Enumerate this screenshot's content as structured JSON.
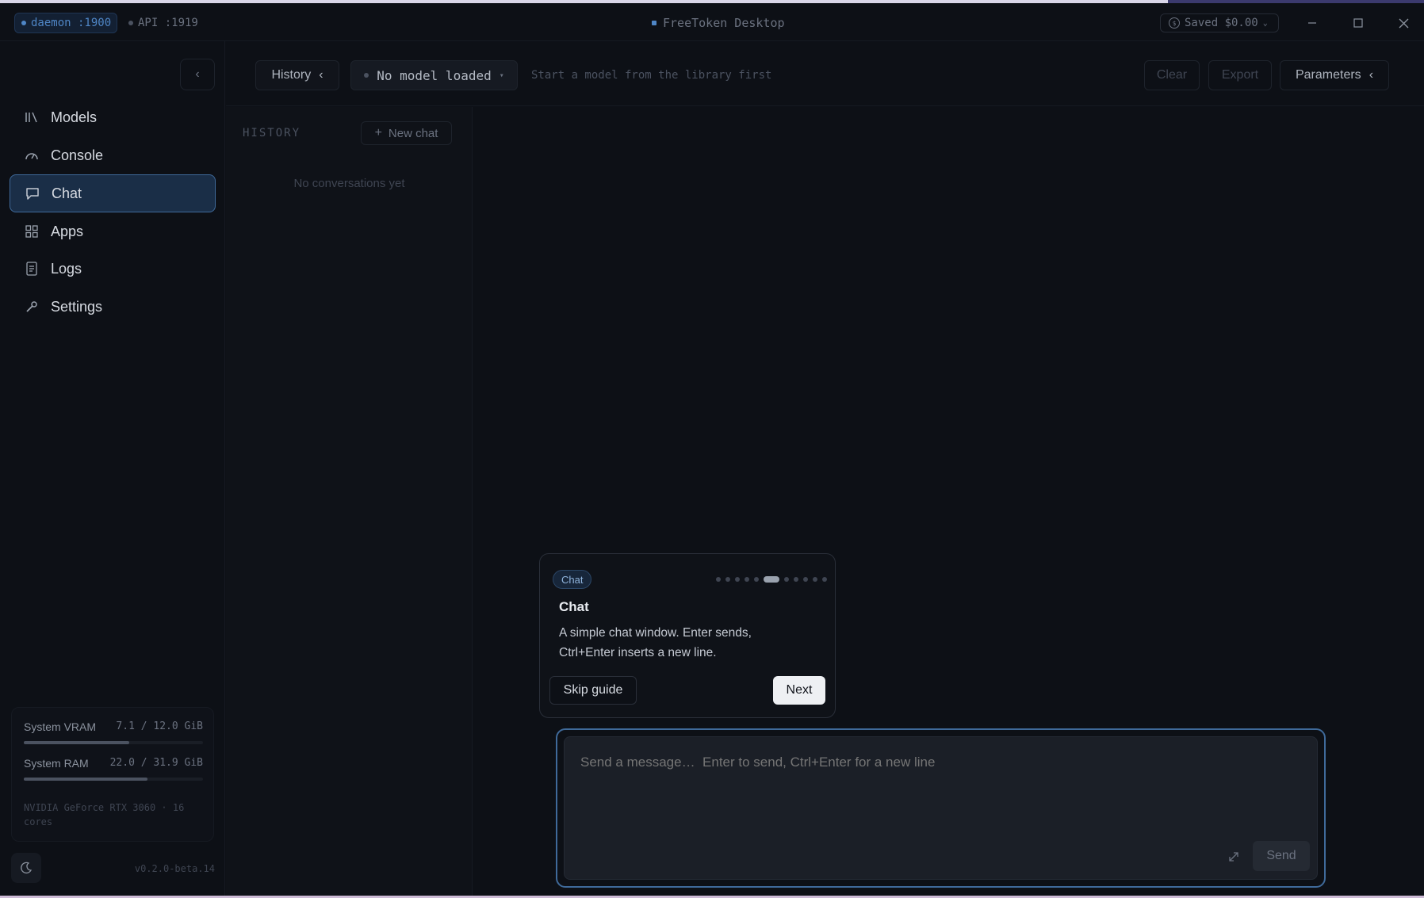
{
  "titlebar": {
    "daemon_label": "daemon :1900",
    "api_label": "API :1919",
    "app_title": "FreeToken Desktop",
    "saved_label": "Saved $0.00",
    "colors": {
      "daemon_dot": "#4f86c6",
      "api_dot": "#4b5260",
      "title_dot": "#4f86c6"
    }
  },
  "sidebar": {
    "items": [
      {
        "label": "Models",
        "icon": "library-icon"
      },
      {
        "label": "Console",
        "icon": "gauge-icon"
      },
      {
        "label": "Chat",
        "icon": "chat-bubble-icon",
        "active": true
      },
      {
        "label": "Apps",
        "icon": "grid-icon"
      },
      {
        "label": "Logs",
        "icon": "logs-icon"
      },
      {
        "label": "Settings",
        "icon": "wrench-icon"
      }
    ],
    "system": {
      "vram_label": "System VRAM",
      "vram_value": "7.1 / 12.0 GiB",
      "vram_fraction": 0.59,
      "ram_label": "System RAM",
      "ram_value": "22.0 / 31.9 GiB",
      "ram_fraction": 0.69,
      "gpu_info": "NVIDIA GeForce RTX 3060 · 16 cores"
    },
    "version": "v0.2.0-beta.14"
  },
  "toolbar": {
    "history_label": "History",
    "model_label": "No model loaded",
    "model_hint": "Start a model from the library first",
    "clear_label": "Clear",
    "export_label": "Export",
    "parameters_label": "Parameters"
  },
  "history": {
    "heading": "HISTORY",
    "new_chat_label": "New chat",
    "empty_text": "No conversations yet"
  },
  "guide": {
    "tag": "Chat",
    "title": "Chat",
    "body": "A simple chat window. Enter sends, Ctrl+Enter inserts a new line.",
    "step_current": 6,
    "step_total": 11,
    "skip_label": "Skip guide",
    "next_label": "Next"
  },
  "composer": {
    "placeholder": "Send a message…  Enter to send, Ctrl+Enter for a new line",
    "send_label": "Send"
  }
}
